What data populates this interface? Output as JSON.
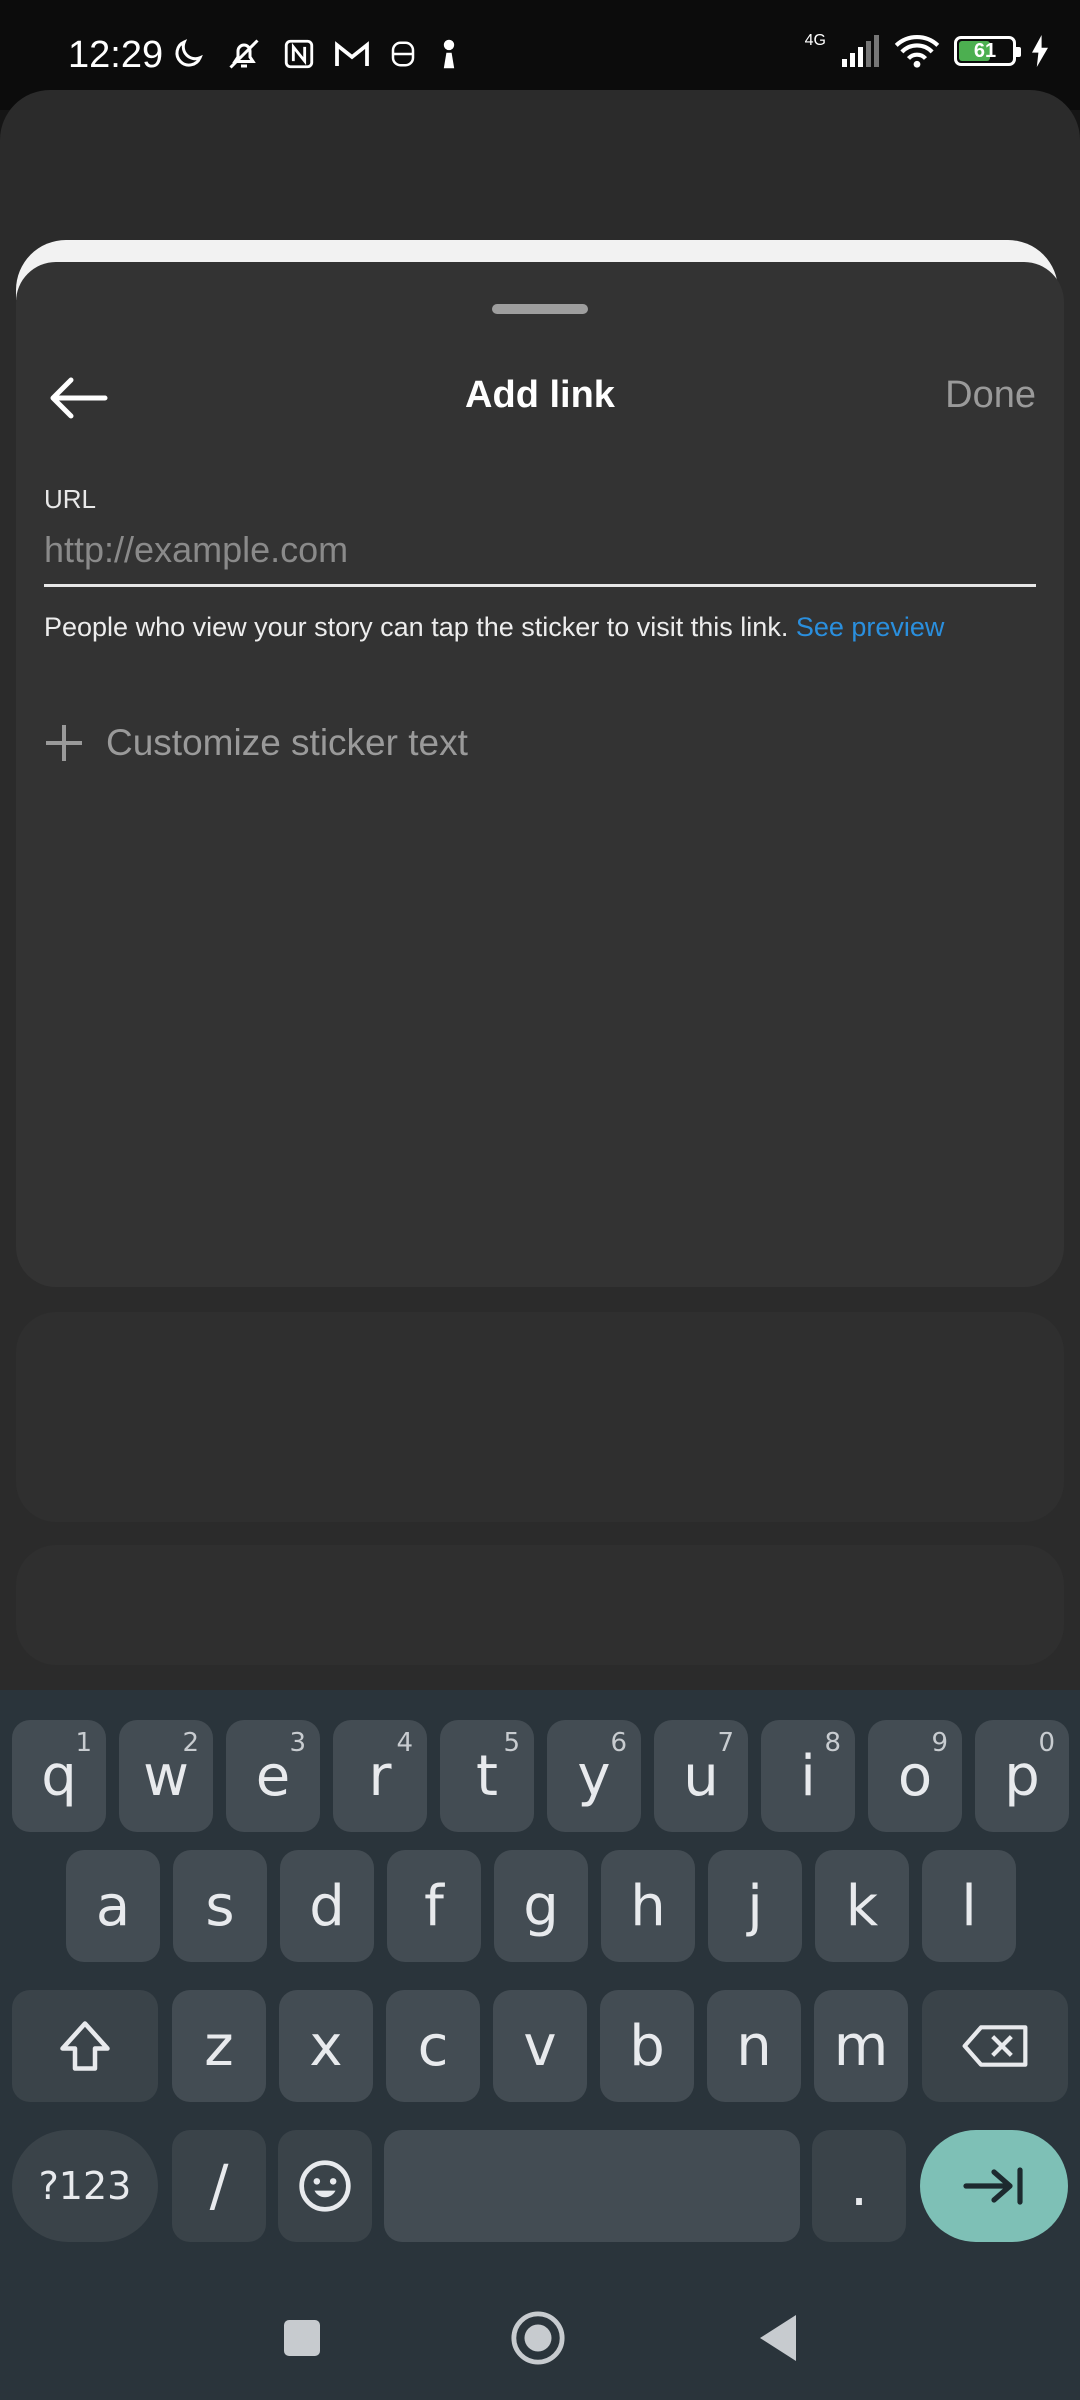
{
  "status_bar": {
    "time": "12:29",
    "network_type": "4G",
    "battery_level": "61",
    "battery_color": "#4caf50",
    "left_icons": [
      "moon-icon",
      "bell-off-icon",
      "nfc-icon",
      "gmail-icon",
      "app-icon",
      "chess-pawn-icon"
    ],
    "right_icons": [
      "signal-icon",
      "wifi-icon",
      "battery-icon",
      "charging-icon"
    ]
  },
  "sheet": {
    "title": "Add link",
    "done_label": "Done",
    "url_label": "URL",
    "url_value": "",
    "url_placeholder": "http://example.com",
    "helper_text": "People who view your story can tap the sticker to visit this link.",
    "preview_link": "See preview",
    "customize_label": "Customize sticker text",
    "link_color": "#2a8fde"
  },
  "keyboard": {
    "row1": [
      {
        "key": "q",
        "hint": "1"
      },
      {
        "key": "w",
        "hint": "2"
      },
      {
        "key": "e",
        "hint": "3"
      },
      {
        "key": "r",
        "hint": "4"
      },
      {
        "key": "t",
        "hint": "5"
      },
      {
        "key": "y",
        "hint": "6"
      },
      {
        "key": "u",
        "hint": "7"
      },
      {
        "key": "i",
        "hint": "8"
      },
      {
        "key": "o",
        "hint": "9"
      },
      {
        "key": "p",
        "hint": "0"
      }
    ],
    "row2": [
      "a",
      "s",
      "d",
      "f",
      "g",
      "h",
      "j",
      "k",
      "l"
    ],
    "row3": [
      "z",
      "x",
      "c",
      "v",
      "b",
      "n",
      "m"
    ],
    "symbols_label": "?123",
    "slash_label": "/",
    "period_label": ".",
    "enter_color": "#7ec0b6"
  },
  "nav_bar": {
    "buttons": [
      "recents-icon",
      "home-icon",
      "back-icon"
    ]
  }
}
